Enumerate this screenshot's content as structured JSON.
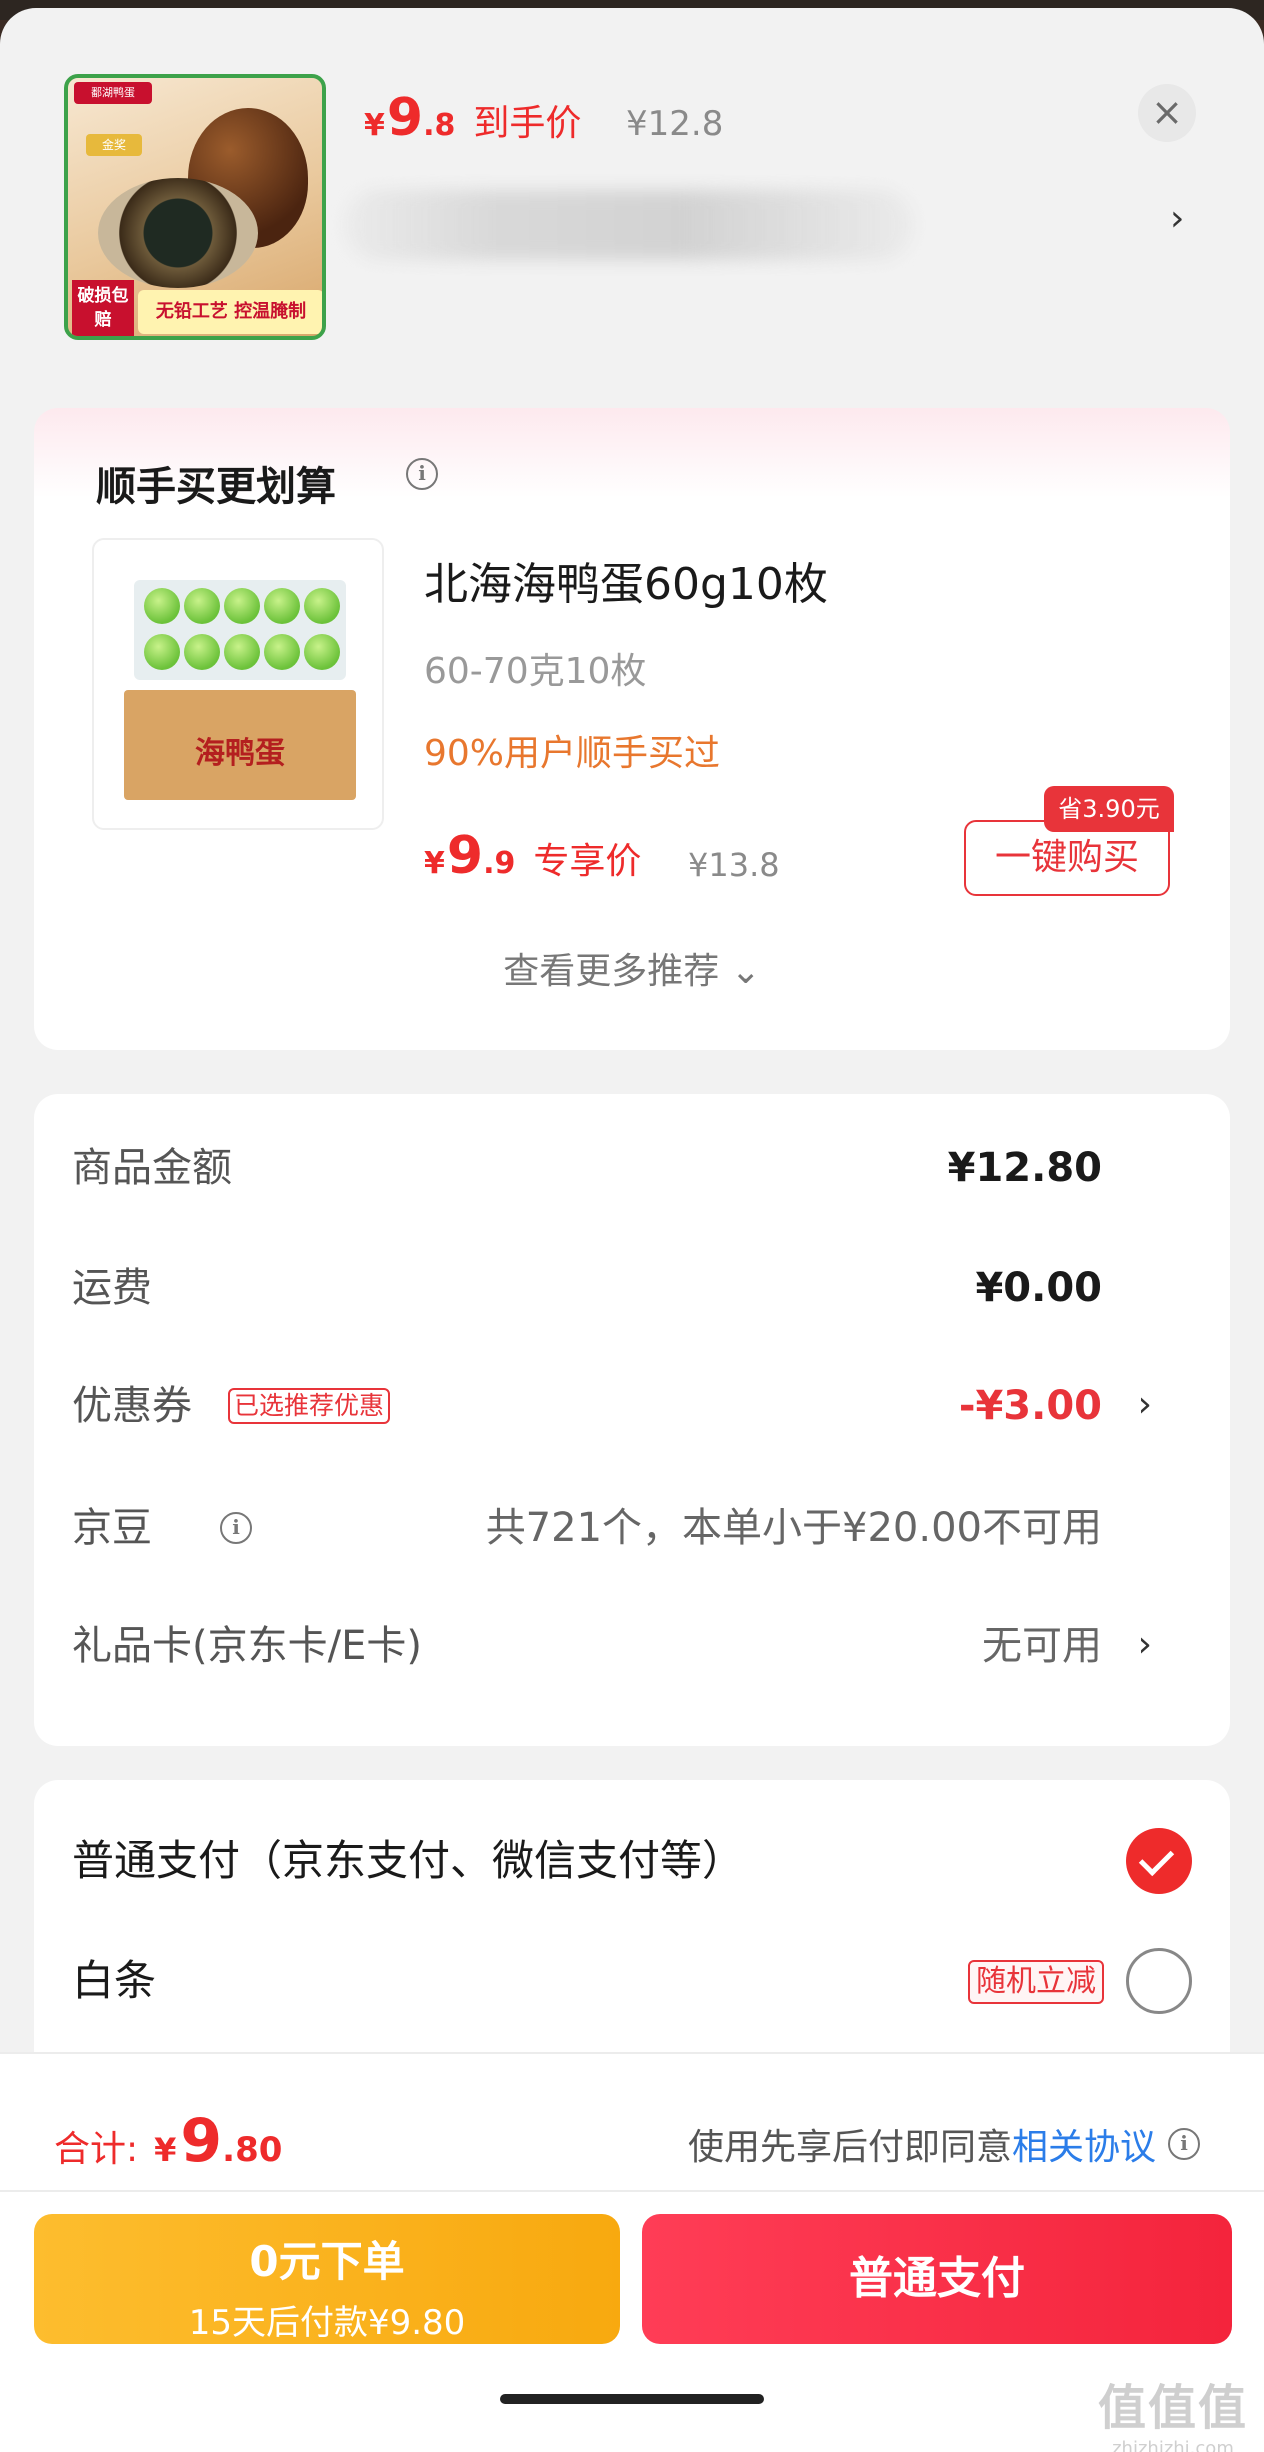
{
  "product": {
    "price_currency": "¥",
    "price_int": "9",
    "price_dec": ".8",
    "price_label": "到手价",
    "original_price": "¥12.8",
    "thumb_badge_left": "破损包赔",
    "thumb_badge_right": "无铅工艺 控温腌制",
    "thumb_badge_top": "鄱湖鸭蛋",
    "thumb_badge_gold": "金奖"
  },
  "recommend": {
    "title": "顺手买更划算",
    "item_name": "北海海鸭蛋60g10枚",
    "item_spec": "60-70克10枚",
    "item_hint": "90%用户顺手买过",
    "price_currency": "¥",
    "price_int": "9",
    "price_dec": ".9",
    "price_label": "专享价",
    "original_price": "¥13.8",
    "save_badge": "省3.90元",
    "buy_button": "一键购买",
    "more_link": "查看更多推荐 ⌄",
    "thumb_box_text": "海鸭蛋"
  },
  "cost": {
    "goods_label": "商品金额",
    "goods_value": "¥12.80",
    "shipping_label": "运费",
    "shipping_value": "¥0.00",
    "coupon_label": "优惠券",
    "coupon_tag": "已选推荐优惠",
    "coupon_value": "-¥3.00",
    "beans_label": "京豆",
    "beans_value": "共721个，本单小于¥20.00不可用",
    "giftcard_label": "礼品卡(京东卡/E卡)",
    "giftcard_value": "无可用"
  },
  "payment": {
    "normal_label": "普通支付（京东支付、微信支付等）",
    "baitiao_label": "白条",
    "baitiao_tag": "随机立减"
  },
  "footer": {
    "total_label": "合计:",
    "total_currency": "¥",
    "total_int": "9",
    "total_dec": ".80",
    "agree_text": "使用先享后付即同意",
    "agree_link": "相关协议",
    "btn_left_line1": "0元下单",
    "btn_left_line2": "15天后付款¥9.80",
    "btn_right": "普通支付",
    "watermark_main": "值值值",
    "watermark_sub": "zhizhizhi.com"
  },
  "icons": {
    "close": "close-icon",
    "chevron": "chevron-right-icon",
    "info": "info-icon",
    "check": "check-icon"
  },
  "colors": {
    "accent_red": "#ee2b2b",
    "accent_orange": "#f8a90f",
    "link_blue": "#2b7de9"
  }
}
